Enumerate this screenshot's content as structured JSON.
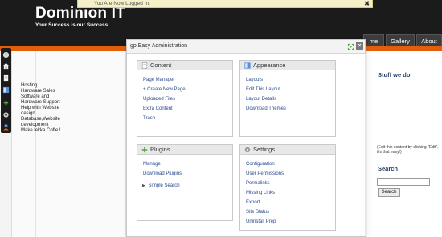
{
  "header": {
    "title": "Dominion IT",
    "tagline": "Your Success is our Success"
  },
  "nav": {
    "home": "me",
    "gallery": "Gallery",
    "about": "About"
  },
  "notice": {
    "text": "You Are Now Logged In.",
    "close_label": "✖"
  },
  "toolbar": {
    "icons": [
      "power-icon",
      "home-icon",
      "page-icon",
      "layout-icon",
      "plugin-icon",
      "settings-icon",
      "user-icon"
    ]
  },
  "admin": {
    "title": "gp|Easy Administration",
    "close_label": "×",
    "panels": {
      "content": {
        "title": "Content",
        "links": [
          "Page Manager",
          "+ Create New Page",
          "Uploaded Files",
          "Extra Content",
          "Trash"
        ]
      },
      "appearance": {
        "title": "Appearance",
        "links": [
          "Layouts",
          "Edit This Layout",
          "Layout Details",
          "Download Themes"
        ]
      },
      "plugins": {
        "title": "Plugins",
        "links": [
          "Manage",
          "Download Plugins"
        ],
        "sub_link": "Simple Search"
      },
      "settings": {
        "title": "Settings",
        "links": [
          "Configuration",
          "User Permissions",
          "Permalinks",
          "Missing Links",
          "Export",
          "Site Status",
          "Uninstall Prep"
        ]
      }
    }
  },
  "sidebar": {
    "stuff_title": "Stuff we do",
    "items": [
      "Hosting",
      "Hardware Sales",
      "Software and Hardware Support",
      "Help with Website design",
      "Database,Website development",
      "Make lekka Coffe !"
    ],
    "note": "(Edit this content by clicking \"Edit\", it's that easy!)",
    "search_title": "Search",
    "search_button": "Search"
  },
  "colors": {
    "header_bg": "#1b1b1b",
    "accent_orange": "#e45d0a",
    "link_blue": "#2b4b8e",
    "sidebar_title": "#1e3a5e"
  }
}
